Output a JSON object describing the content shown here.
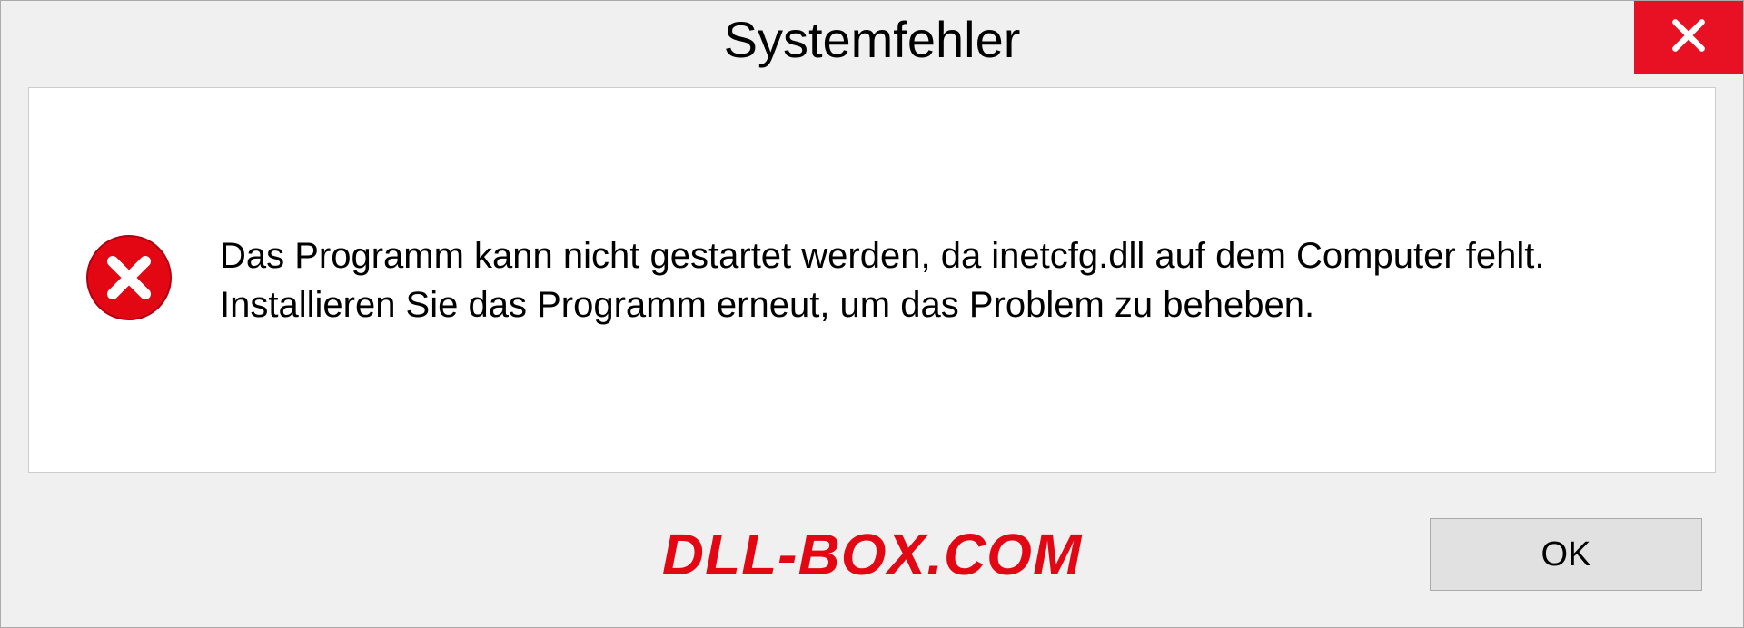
{
  "dialog": {
    "title": "Systemfehler",
    "message": "Das Programm kann nicht gestartet werden, da inetcfg.dll auf dem Computer fehlt. Installieren Sie das Programm erneut, um das Problem zu beheben.",
    "ok_label": "OK"
  },
  "watermark": "DLL-BOX.COM"
}
